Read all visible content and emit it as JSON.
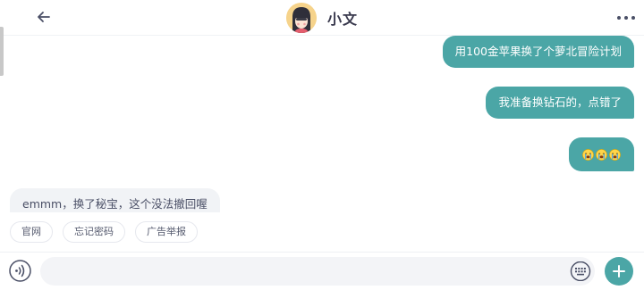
{
  "header": {
    "title": "小文",
    "back_icon": "arrow-left-icon",
    "more_icon": "more-dots-icon",
    "avatar_icon": "girl-avatar"
  },
  "messages": [
    {
      "side": "out",
      "text": "用100金苹果换了个萝北冒险计划"
    },
    {
      "side": "out",
      "text": "我准备换钻石的，点错了"
    },
    {
      "side": "out",
      "text": "",
      "emojis": [
        "crying-face-emoji",
        "crying-face-emoji",
        "crying-face-emoji"
      ]
    },
    {
      "side": "in",
      "text": "emmm，换了秘宝，这个没法撤回喔"
    }
  ],
  "quick_replies": [
    "官网",
    "忘记密码",
    "广告举报"
  ],
  "input": {
    "value": "",
    "placeholder": "",
    "voice_icon": "voice-icon",
    "keyboard_icon": "keyboard-icon",
    "add_icon": "plus-icon"
  },
  "colors": {
    "accent": "#4ba6a6",
    "incoming_bg": "#f1f3f6",
    "text_dark": "#3a3a4e"
  }
}
